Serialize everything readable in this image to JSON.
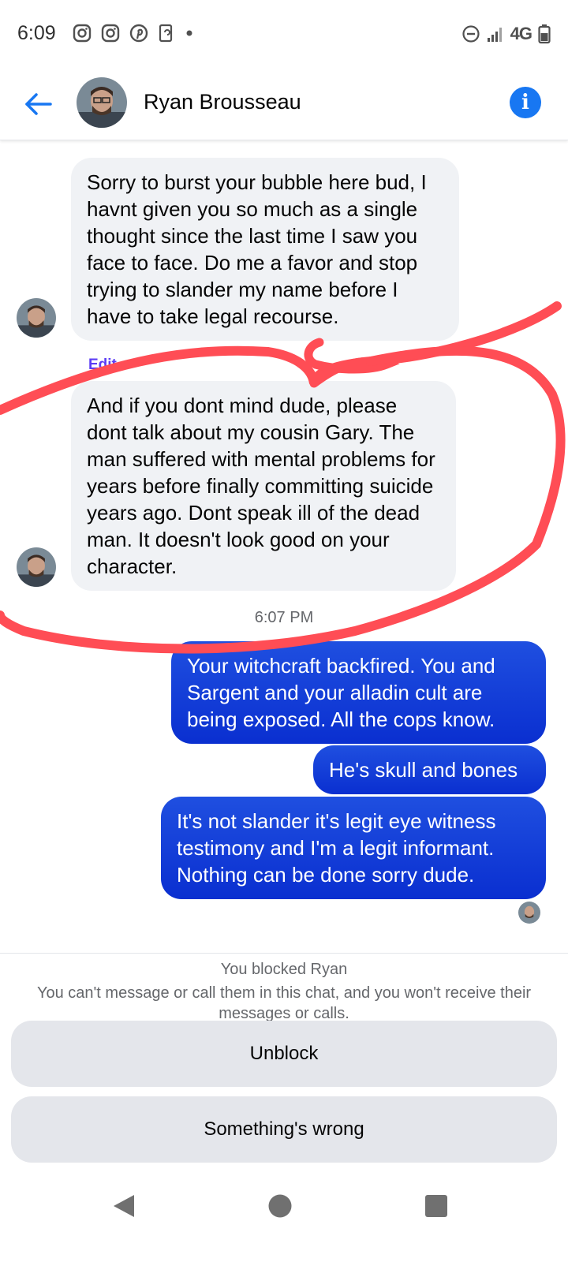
{
  "status_bar": {
    "time": "6:09",
    "network": "4G",
    "icons_left": [
      "instagram-icon",
      "instagram-icon",
      "pinterest-icon",
      "phone-sync-icon",
      "dot-icon"
    ],
    "icons_right": [
      "do-not-disturb-icon",
      "signal-icon",
      "battery-icon"
    ]
  },
  "header": {
    "name": "Ryan Brousseau",
    "back_icon": "back-arrow-icon",
    "info_icon": "info-icon",
    "info_glyph": "i"
  },
  "messages": {
    "incoming_1": "Sorry to burst your bubble here bud, I havnt given you so much as a single thought since the last time I saw you face to face. Do me a favor and stop trying to slander my name before I have to take legal recourse.",
    "edited_label": "Edit",
    "incoming_2": "And if you dont mind dude, please dont talk about my cousin Gary. The man suffered with mental problems for years before finally committing suicide years ago. Dont speak ill of the dead man. It doesn't look good on your character.",
    "timestamp": "6:07 PM",
    "outgoing_1": "Your witchcraft backfired. You and Sargent and your alladin cult are being exposed. All the cops know.",
    "outgoing_2": "He's skull and bones",
    "outgoing_3": "It's not slander it's legit eye witness testimony and I'm a legit informant. Nothing can be done sorry dude."
  },
  "block_notice": {
    "title": "You blocked Ryan",
    "description": "You can't message or call them in this chat, and you won't receive their messages or calls.",
    "unblock_label": "Unblock",
    "report_label": "Something's wrong"
  },
  "colors": {
    "accent": "#1877f2",
    "outgoing_bubble": "#0a2fd0",
    "incoming_bubble": "#f0f2f5",
    "annotation": "#ff4d55"
  }
}
